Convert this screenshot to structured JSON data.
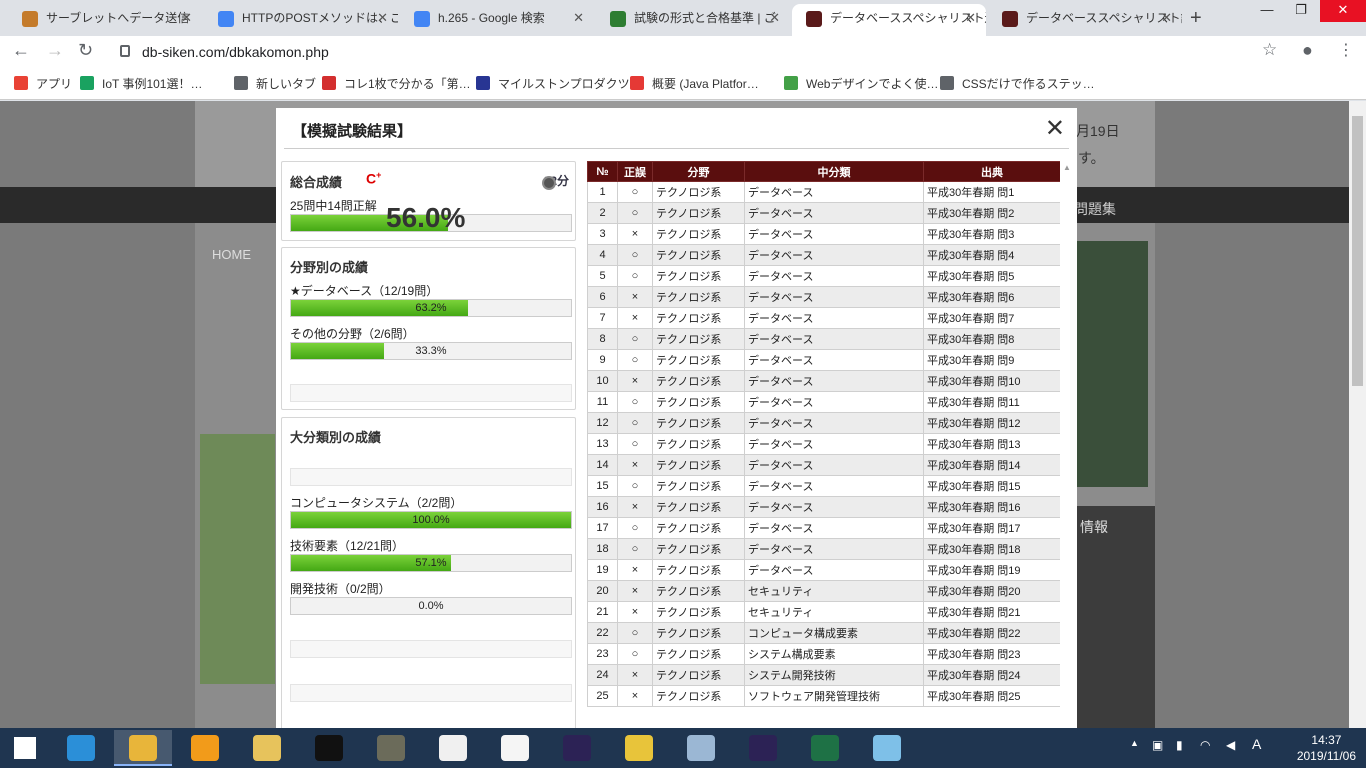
{
  "browser": {
    "tabs": [
      {
        "title": "サーブレットへデータ送信",
        "icon_color": "#c47b2b"
      },
      {
        "title": "HTTPのPOSTメソッドは、ご",
        "icon_color": "#4285f4"
      },
      {
        "title": "h.265 - Google 検索",
        "icon_color": "#4285f4"
      },
      {
        "title": "試験の形式と合格基準 | ご",
        "icon_color": "#2e7d32"
      },
      {
        "title": "データベーススペシャリスト過",
        "icon_color": "#5a1a1a",
        "active": true
      },
      {
        "title": "データベーススペシャリスト試",
        "icon_color": "#5a1a1a"
      }
    ],
    "new_tab": "+",
    "window_controls": {
      "minimize": "—",
      "restore": "❐",
      "close": "✕"
    },
    "url": "db-siken.com/dbkakomon.php",
    "bookmarks": [
      {
        "label": "アプリ",
        "icon_color": "#e94235"
      },
      {
        "label": "IoT 事例101選！…",
        "icon_color": "#1aa260"
      },
      {
        "label": "新しいタブ",
        "icon_color": "#5f6368"
      },
      {
        "label": "コレ1枚で分かる「第…",
        "icon_color": "#d32f2f"
      },
      {
        "label": "マイルストンプロダクツ…",
        "icon_color": "#283593"
      },
      {
        "label": "概要 (Java Platfor…",
        "icon_color": "#e53935"
      },
      {
        "label": "Webデザインでよく使…",
        "icon_color": "#43a047"
      },
      {
        "label": "CSSだけで作るステッ…",
        "icon_color": "#5f6368"
      }
    ]
  },
  "background_page": {
    "home": "HOME",
    "date_fragment": "月19日",
    "text_fragment": "す。",
    "nav_fragment": "問題集",
    "side_fragment": "情報"
  },
  "modal": {
    "title": "【模擬試験結果】",
    "close": "✕",
    "overall": {
      "heading": "総合成績",
      "grade": "C",
      "grade_mark": "+",
      "time": "22分",
      "correct_text": "25問中14問正解",
      "percent_value": 56.0,
      "percent_text": "56.0%"
    },
    "by_field": {
      "heading": "分野別の成績",
      "items": [
        {
          "label": "★データベース（12/19問）",
          "value": 63.2,
          "text": "63.2%"
        },
        {
          "label": "その他の分野（2/6問）",
          "value": 33.3,
          "text": "33.3%"
        }
      ]
    },
    "by_category": {
      "heading": "大分類別の成績",
      "items": [
        {
          "label": "コンピュータシステム（2/2問）",
          "value": 100.0,
          "text": "100.0%"
        },
        {
          "label": "技術要素（12/21問）",
          "value": 57.1,
          "text": "57.1%"
        },
        {
          "label": "開発技術（0/2問）",
          "value": 0.0,
          "text": "0.0%"
        }
      ]
    },
    "table": {
      "headers": [
        "№",
        "正誤",
        "分野",
        "中分類",
        "出典"
      ],
      "rows": [
        [
          "1",
          "○",
          "テクノロジ系",
          "データベース",
          "平成30年春期 問1"
        ],
        [
          "2",
          "○",
          "テクノロジ系",
          "データベース",
          "平成30年春期 問2"
        ],
        [
          "3",
          "×",
          "テクノロジ系",
          "データベース",
          "平成30年春期 問3"
        ],
        [
          "4",
          "○",
          "テクノロジ系",
          "データベース",
          "平成30年春期 問4"
        ],
        [
          "5",
          "○",
          "テクノロジ系",
          "データベース",
          "平成30年春期 問5"
        ],
        [
          "6",
          "×",
          "テクノロジ系",
          "データベース",
          "平成30年春期 問6"
        ],
        [
          "7",
          "×",
          "テクノロジ系",
          "データベース",
          "平成30年春期 問7"
        ],
        [
          "8",
          "○",
          "テクノロジ系",
          "データベース",
          "平成30年春期 問8"
        ],
        [
          "9",
          "○",
          "テクノロジ系",
          "データベース",
          "平成30年春期 問9"
        ],
        [
          "10",
          "×",
          "テクノロジ系",
          "データベース",
          "平成30年春期 問10"
        ],
        [
          "11",
          "○",
          "テクノロジ系",
          "データベース",
          "平成30年春期 問11"
        ],
        [
          "12",
          "○",
          "テクノロジ系",
          "データベース",
          "平成30年春期 問12"
        ],
        [
          "13",
          "○",
          "テクノロジ系",
          "データベース",
          "平成30年春期 問13"
        ],
        [
          "14",
          "×",
          "テクノロジ系",
          "データベース",
          "平成30年春期 問14"
        ],
        [
          "15",
          "○",
          "テクノロジ系",
          "データベース",
          "平成30年春期 問15"
        ],
        [
          "16",
          "×",
          "テクノロジ系",
          "データベース",
          "平成30年春期 問16"
        ],
        [
          "17",
          "○",
          "テクノロジ系",
          "データベース",
          "平成30年春期 問17"
        ],
        [
          "18",
          "○",
          "テクノロジ系",
          "データベース",
          "平成30年春期 問18"
        ],
        [
          "19",
          "×",
          "テクノロジ系",
          "データベース",
          "平成30年春期 問19"
        ],
        [
          "20",
          "×",
          "テクノロジ系",
          "セキュリティ",
          "平成30年春期 問20"
        ],
        [
          "21",
          "×",
          "テクノロジ系",
          "セキュリティ",
          "平成30年春期 問21"
        ],
        [
          "22",
          "○",
          "テクノロジ系",
          "コンピュータ構成要素",
          "平成30年春期 問22"
        ],
        [
          "23",
          "○",
          "テクノロジ系",
          "システム構成要素",
          "平成30年春期 問23"
        ],
        [
          "24",
          "×",
          "テクノロジ系",
          "システム開発技術",
          "平成30年春期 問24"
        ],
        [
          "25",
          "×",
          "テクノロジ系",
          "ソフトウェア開発管理技術",
          "平成30年春期 問25"
        ]
      ]
    }
  },
  "taskbar": {
    "apps": [
      {
        "name": "start",
        "color": "#ffffff"
      },
      {
        "name": "ie",
        "color": "#2b8fd8"
      },
      {
        "name": "chrome",
        "color": "#e8b53a",
        "active": true
      },
      {
        "name": "sublime",
        "color": "#f29b1a"
      },
      {
        "name": "explorer",
        "color": "#e7c35c"
      },
      {
        "name": "cmd",
        "color": "#111111"
      },
      {
        "name": "gimp",
        "color": "#6b6b5a"
      },
      {
        "name": "notepad",
        "color": "#f0f0f0"
      },
      {
        "name": "unity",
        "color": "#f5f5f5"
      },
      {
        "name": "eclipse",
        "color": "#2c2255"
      },
      {
        "name": "ffftp",
        "color": "#e8c43a"
      },
      {
        "name": "monitor",
        "color": "#9bb7d4"
      },
      {
        "name": "eclipse2",
        "color": "#2c2255"
      },
      {
        "name": "excel",
        "color": "#1e7145"
      },
      {
        "name": "notes",
        "color": "#7ec0e8"
      }
    ],
    "ime": "A",
    "time": "14:37",
    "date": "2019/11/06"
  }
}
